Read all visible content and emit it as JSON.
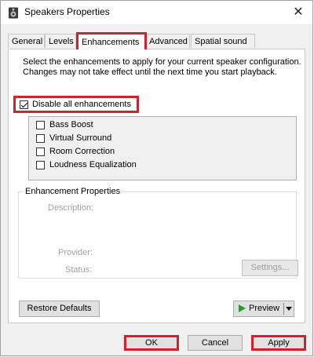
{
  "window": {
    "title": "Speakers Properties",
    "close_label": "✕"
  },
  "tabs": [
    {
      "label": "General"
    },
    {
      "label": "Levels"
    },
    {
      "label": "Enhancements"
    },
    {
      "label": "Advanced"
    },
    {
      "label": "Spatial sound"
    }
  ],
  "selected_tab": "Enhancements",
  "enhancements": {
    "intro": "Select the enhancements to apply for your current speaker configuration. Changes may not take effect until the next time you start playback.",
    "disable_all": {
      "label": "Disable all enhancements",
      "checked": true
    },
    "items": [
      {
        "label": "Bass Boost",
        "checked": false
      },
      {
        "label": "Virtual Surround",
        "checked": false
      },
      {
        "label": "Room Correction",
        "checked": false
      },
      {
        "label": "Loudness Equalization",
        "checked": false
      }
    ],
    "properties": {
      "title": "Enhancement Properties",
      "description_label": "Description:",
      "provider_label": "Provider:",
      "status_label": "Status:",
      "settings_label": "Settings..."
    },
    "restore_defaults_label": "Restore Defaults",
    "preview_label": "Preview"
  },
  "footer": {
    "ok_label": "OK",
    "cancel_label": "Cancel",
    "apply_label": "Apply"
  },
  "colors": {
    "highlight": "#d3202d",
    "preview_play": "#2c9b2c"
  }
}
